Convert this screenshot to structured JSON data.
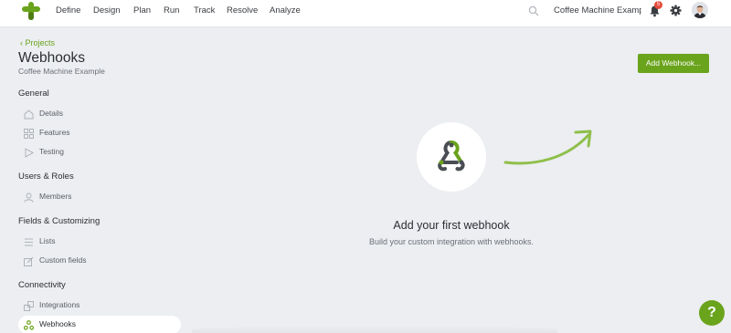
{
  "nav": {
    "items": [
      {
        "label": "Define"
      },
      {
        "label": "Design"
      },
      {
        "label": "Plan"
      },
      {
        "label": "Run"
      },
      {
        "label": "Track"
      },
      {
        "label": "Resolve"
      },
      {
        "label": "Analyze"
      }
    ],
    "project_selector": "Coffee Machine Examp...",
    "notification_count": "5"
  },
  "header": {
    "back_label": "Projects",
    "title": "Webhooks",
    "subtitle": "Coffee Machine Example",
    "add_button_label": "Add Webhook..."
  },
  "sidebar": {
    "sections": [
      {
        "title": "General",
        "items": [
          {
            "label": "Details",
            "icon": "home-icon"
          },
          {
            "label": "Features",
            "icon": "grid-icon"
          },
          {
            "label": "Testing",
            "icon": "play-icon"
          }
        ]
      },
      {
        "title": "Users & Roles",
        "items": [
          {
            "label": "Members",
            "icon": "user-icon"
          }
        ]
      },
      {
        "title": "Fields & Customizing",
        "items": [
          {
            "label": "Lists",
            "icon": "list-icon"
          },
          {
            "label": "Custom fields",
            "icon": "edit-icon"
          }
        ]
      },
      {
        "title": "Connectivity",
        "items": [
          {
            "label": "Integrations",
            "icon": "puzzle-icon"
          },
          {
            "label": "Webhooks",
            "icon": "webhook-icon",
            "active": true
          }
        ]
      }
    ]
  },
  "empty_state": {
    "title": "Add your first webhook",
    "subtitle": "Build your custom integration with webhooks."
  },
  "help": {
    "label": "?"
  },
  "colors": {
    "accent": "#6aa31c",
    "badge": "#e74c3c",
    "background": "#eceef1"
  }
}
